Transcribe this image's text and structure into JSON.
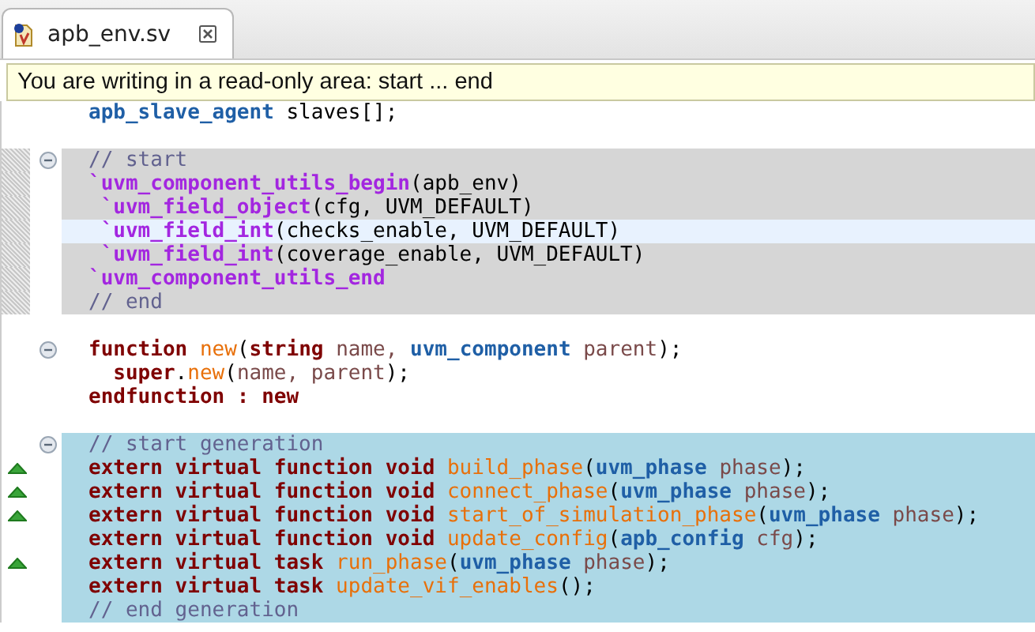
{
  "tab": {
    "title": "apb_env.sv",
    "selected": true
  },
  "tooltip": "You are writing in a read-only area: start ... end",
  "lines": [
    {
      "read_only": false,
      "generated": false,
      "current": false,
      "tokens": [
        {
          "kind": "type",
          "text": "apb_slave_agent"
        },
        {
          "kind": "plain",
          "text": " slaves[];"
        }
      ]
    },
    {
      "read_only": false,
      "generated": false,
      "current": false
    },
    {
      "read_only": true,
      "generated": false,
      "current": false,
      "expanded": true,
      "tokens": [
        {
          "kind": "comment",
          "text": "// start"
        }
      ]
    },
    {
      "read_only": true,
      "generated": false,
      "current": false,
      "tokens": [
        {
          "kind": "macro",
          "text": "`uvm_component_utils_begin"
        },
        {
          "kind": "plain",
          "text": "(apb_env)"
        }
      ]
    },
    {
      "read_only": true,
      "generated": false,
      "current": false,
      "tokens": [
        {
          "kind": "macro",
          "text": " `uvm_field_object"
        },
        {
          "kind": "plain",
          "text": "(cfg, UVM_DEFAULT)"
        }
      ]
    },
    {
      "read_only": true,
      "generated": false,
      "current": true,
      "tokens": [
        {
          "kind": "macro",
          "text": " `uvm_field_int"
        },
        {
          "kind": "plain",
          "text": "(checks_enable, UVM_DEFAULT)"
        }
      ]
    },
    {
      "read_only": true,
      "generated": false,
      "current": false,
      "tokens": [
        {
          "kind": "macro",
          "text": " `uvm_field_int"
        },
        {
          "kind": "plain",
          "text": "(coverage_enable, UVM_DEFAULT)"
        }
      ]
    },
    {
      "read_only": true,
      "generated": false,
      "current": false,
      "tokens": [
        {
          "kind": "macro",
          "text": "`uvm_component_utils_end"
        }
      ]
    },
    {
      "read_only": true,
      "generated": false,
      "current": false,
      "tokens": [
        {
          "kind": "comment",
          "text": "// end"
        }
      ]
    },
    {
      "read_only": false,
      "generated": false,
      "current": false
    },
    {
      "read_only": false,
      "generated": false,
      "current": false,
      "expanded": true,
      "tokens": [
        {
          "kind": "keyword",
          "text": "function "
        },
        {
          "kind": "method",
          "text": "new"
        },
        {
          "kind": "plain",
          "text": "("
        },
        {
          "kind": "keyword",
          "text": "string "
        },
        {
          "kind": "ident",
          "text": "name, "
        },
        {
          "kind": "type",
          "text": "uvm_component "
        },
        {
          "kind": "ident",
          "text": "parent"
        },
        {
          "kind": "plain",
          "text": ");"
        }
      ]
    },
    {
      "read_only": false,
      "generated": false,
      "current": false,
      "tokens": [
        {
          "kind": "keyword",
          "text": "  super"
        },
        {
          "kind": "plain",
          "text": "."
        },
        {
          "kind": "method",
          "text": "new"
        },
        {
          "kind": "plain",
          "text": "("
        },
        {
          "kind": "ident",
          "text": "name, parent"
        },
        {
          "kind": "plain",
          "text": ");"
        }
      ]
    },
    {
      "read_only": false,
      "generated": false,
      "current": false,
      "tokens": [
        {
          "kind": "keyword",
          "text": "endfunction : new"
        }
      ]
    },
    {
      "read_only": false,
      "generated": false,
      "current": false
    },
    {
      "read_only": false,
      "generated": true,
      "current": false,
      "expanded": true,
      "tokens": [
        {
          "kind": "comment",
          "text": "// start generation"
        }
      ]
    },
    {
      "read_only": false,
      "generated": true,
      "current": false,
      "override": true,
      "tokens": [
        {
          "kind": "keyword",
          "text": "extern virtual function void "
        },
        {
          "kind": "method",
          "text": "build_phase"
        },
        {
          "kind": "plain",
          "text": "("
        },
        {
          "kind": "type",
          "text": "uvm_phase "
        },
        {
          "kind": "ident",
          "text": "phase"
        },
        {
          "kind": "plain",
          "text": ");"
        }
      ]
    },
    {
      "read_only": false,
      "generated": true,
      "current": false,
      "override": true,
      "tokens": [
        {
          "kind": "keyword",
          "text": "extern virtual function void "
        },
        {
          "kind": "method",
          "text": "connect_phase"
        },
        {
          "kind": "plain",
          "text": "("
        },
        {
          "kind": "type",
          "text": "uvm_phase "
        },
        {
          "kind": "ident",
          "text": "phase"
        },
        {
          "kind": "plain",
          "text": ");"
        }
      ]
    },
    {
      "read_only": false,
      "generated": true,
      "current": false,
      "override": true,
      "tokens": [
        {
          "kind": "keyword",
          "text": "extern virtual function void "
        },
        {
          "kind": "method",
          "text": "start_of_simulation_phase"
        },
        {
          "kind": "plain",
          "text": "("
        },
        {
          "kind": "type",
          "text": "uvm_phase "
        },
        {
          "kind": "ident",
          "text": "phase"
        },
        {
          "kind": "plain",
          "text": ");"
        }
      ]
    },
    {
      "read_only": false,
      "generated": true,
      "current": false,
      "tokens": [
        {
          "kind": "keyword",
          "text": "extern virtual function void "
        },
        {
          "kind": "method",
          "text": "update_config"
        },
        {
          "kind": "plain",
          "text": "("
        },
        {
          "kind": "type",
          "text": "apb_config "
        },
        {
          "kind": "ident",
          "text": "cfg"
        },
        {
          "kind": "plain",
          "text": ");"
        }
      ]
    },
    {
      "read_only": false,
      "generated": true,
      "current": false,
      "override": true,
      "tokens": [
        {
          "kind": "keyword",
          "text": "extern virtual task "
        },
        {
          "kind": "method",
          "text": "run_phase"
        },
        {
          "kind": "plain",
          "text": "("
        },
        {
          "kind": "type",
          "text": "uvm_phase "
        },
        {
          "kind": "ident",
          "text": "phase"
        },
        {
          "kind": "plain",
          "text": ");"
        }
      ]
    },
    {
      "read_only": false,
      "generated": true,
      "current": false,
      "tokens": [
        {
          "kind": "keyword",
          "text": "extern virtual task "
        },
        {
          "kind": "method",
          "text": "update_vif_enables"
        },
        {
          "kind": "plain",
          "text": "();"
        }
      ]
    },
    {
      "read_only": false,
      "generated": true,
      "current": false,
      "tokens": [
        {
          "kind": "comment",
          "text": "// end generation"
        }
      ]
    }
  ]
}
